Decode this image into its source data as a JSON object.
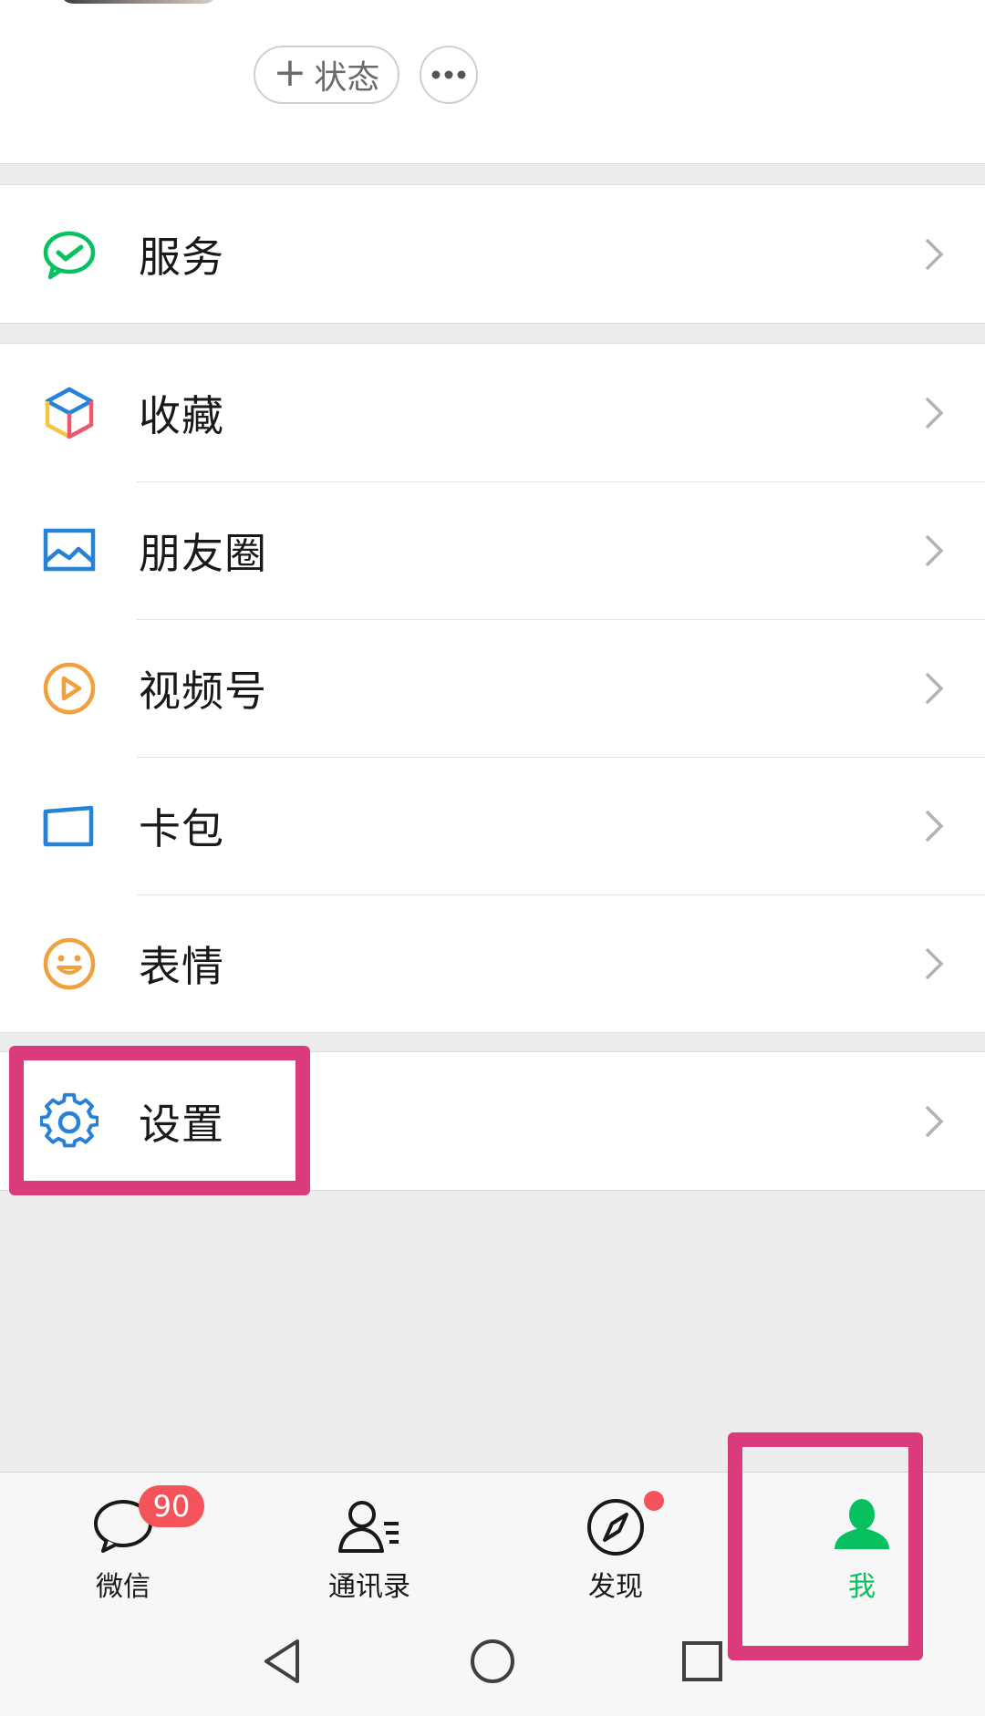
{
  "profile": {
    "status_button": {
      "plus": "+",
      "label": "状态"
    },
    "more_button": {
      "icon": "more-dots-icon"
    }
  },
  "menu": {
    "service": {
      "label": "服务",
      "icon": "wechat-pay-icon",
      "color": "#07c160"
    },
    "group2": [
      {
        "label": "收藏",
        "icon": "favorites-cube-icon"
      },
      {
        "label": "朋友圈",
        "icon": "moments-image-icon",
        "color": "#2782d7"
      },
      {
        "label": "视频号",
        "icon": "channels-play-icon",
        "color": "#f0a03c"
      },
      {
        "label": "卡包",
        "icon": "card-wallet-icon",
        "color": "#2782d7"
      },
      {
        "label": "表情",
        "icon": "sticker-smile-icon",
        "color": "#f0a03c"
      }
    ],
    "settings": {
      "label": "设置",
      "icon": "gear-icon",
      "color": "#2782d7"
    }
  },
  "tabbar": {
    "tabs": [
      {
        "label": "微信",
        "icon": "chat-bubble-icon",
        "badge": "90"
      },
      {
        "label": "通讯录",
        "icon": "contacts-icon"
      },
      {
        "label": "发现",
        "icon": "compass-icon",
        "red_dot": true
      },
      {
        "label": "我",
        "icon": "me-person-icon",
        "active": true
      }
    ],
    "active_color": "#07c160"
  },
  "system_nav": [
    "back-icon",
    "home-icon",
    "recents-icon"
  ],
  "highlight_color": "#db3a7b"
}
